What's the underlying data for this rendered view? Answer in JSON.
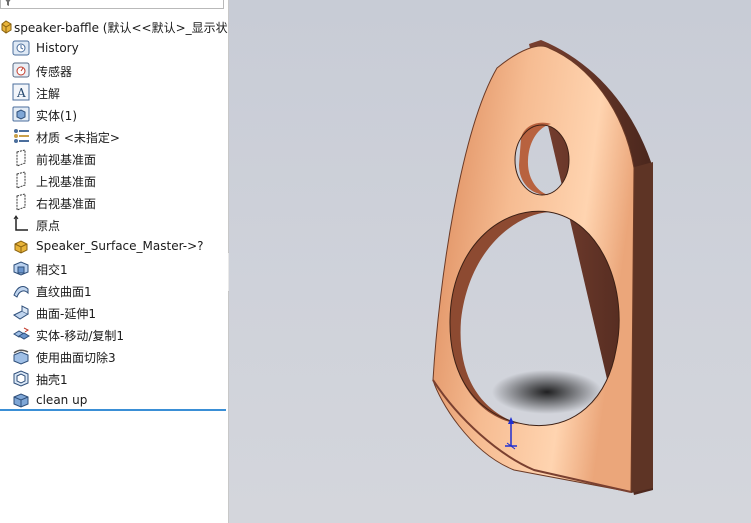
{
  "document": {
    "title": "speaker-baffle  (默认<<默认>_显示状"
  },
  "tree": {
    "items": [
      {
        "label": "History",
        "icon": "history-icon"
      },
      {
        "label": "传感器",
        "icon": "sensor-icon"
      },
      {
        "label": "注解",
        "icon": "annotation-icon"
      },
      {
        "label": "实体(1)",
        "icon": "solid-bodies-icon"
      },
      {
        "label": "材质 <未指定>",
        "icon": "material-icon"
      },
      {
        "label": "前视基准面",
        "icon": "plane-icon"
      },
      {
        "label": "上视基准面",
        "icon": "plane-icon"
      },
      {
        "label": "右视基准面",
        "icon": "plane-icon"
      },
      {
        "label": "原点",
        "icon": "origin-icon"
      },
      {
        "label": "Speaker_Surface_Master->?",
        "icon": "external-part-icon"
      },
      {
        "label": "相交1",
        "icon": "intersect-icon"
      },
      {
        "label": "直纹曲面1",
        "icon": "ruled-surface-icon"
      },
      {
        "label": "曲面-延伸1",
        "icon": "surface-extend-icon"
      },
      {
        "label": "实体-移动/复制1",
        "icon": "move-copy-body-icon"
      },
      {
        "label": "使用曲面切除3",
        "icon": "surface-cut-icon"
      },
      {
        "label": "抽壳1",
        "icon": "shell-icon"
      },
      {
        "label": "clean up",
        "icon": "clean-up-icon"
      }
    ]
  },
  "colors": {
    "part_face": "#e59a6e",
    "part_edge": "#5a3326",
    "rollback_bar": "#3a8fd6"
  }
}
